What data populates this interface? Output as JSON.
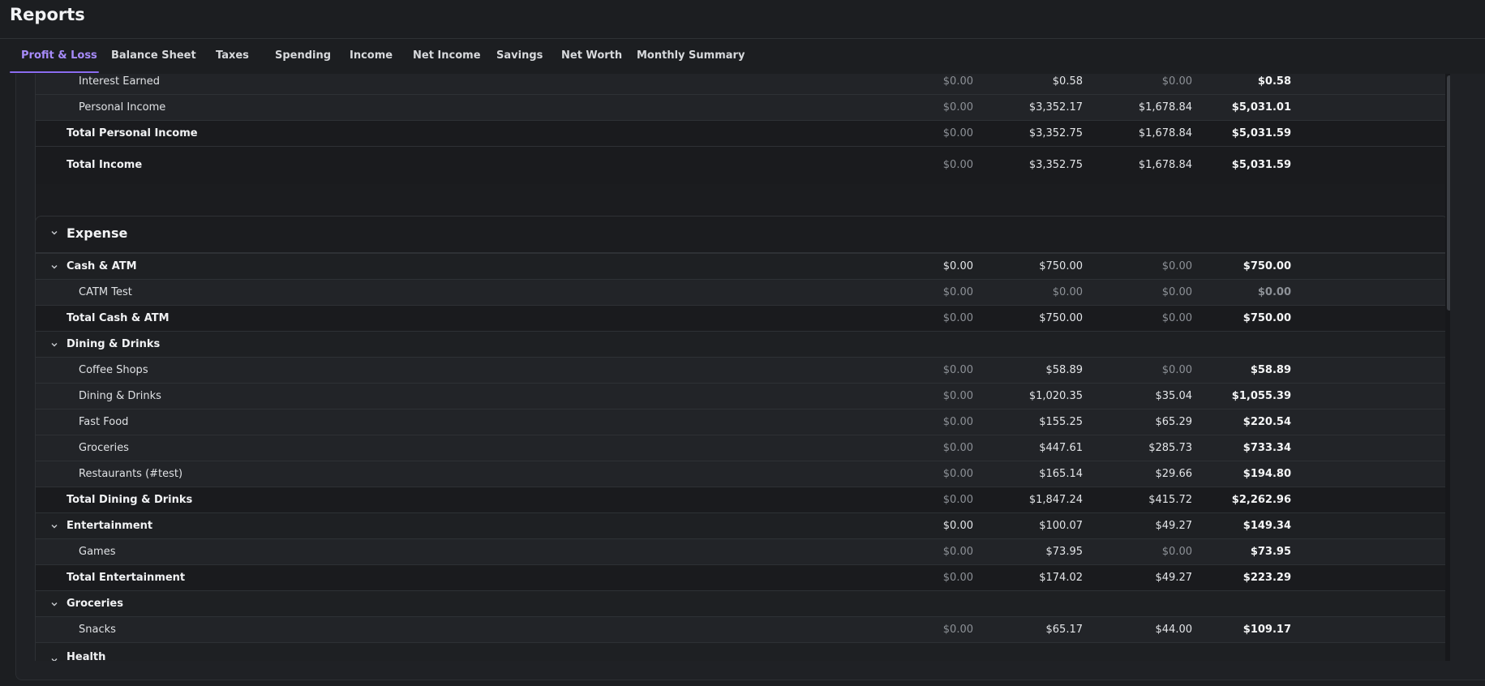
{
  "app": {
    "title": "Reports"
  },
  "tabs": [
    {
      "label": "Profit & Loss",
      "active": true
    },
    {
      "label": "Balance Sheet"
    },
    {
      "label": "Taxes"
    },
    {
      "label": "Spending"
    },
    {
      "label": "Income"
    },
    {
      "label": "Net Income"
    },
    {
      "label": "Savings"
    },
    {
      "label": "Net Worth"
    },
    {
      "label": "Monthly Summary"
    }
  ],
  "colors": {
    "accent": "#a78bfa",
    "background": "#1c1e21",
    "muted_value": "#8d9197"
  },
  "income_section": {
    "rows": [
      {
        "label": "Interest Earned",
        "values": [
          "$0.00",
          "$0.58",
          "$0.00",
          "$0.58"
        ]
      },
      {
        "label": "Personal Income",
        "values": [
          "$0.00",
          "$3,352.17",
          "$1,678.84",
          "$5,031.01"
        ]
      },
      {
        "label": "Total Personal Income",
        "values": [
          "$0.00",
          "$3,352.75",
          "$1,678.84",
          "$5,031.59"
        ]
      },
      {
        "label": "Total Income",
        "values": [
          "$0.00",
          "$3,352.75",
          "$1,678.84",
          "$5,031.59"
        ]
      }
    ]
  },
  "expense_section": {
    "title": "Expense",
    "rows": [
      {
        "label": "Cash & ATM",
        "values": [
          "$0.00",
          "$750.00",
          "$0.00",
          "$750.00"
        ]
      },
      {
        "label": "CATM Test",
        "values": [
          "$0.00",
          "$0.00",
          "$0.00",
          "$0.00"
        ]
      },
      {
        "label": "Total Cash & ATM",
        "values": [
          "$0.00",
          "$750.00",
          "$0.00",
          "$750.00"
        ]
      },
      {
        "label": "Dining & Drinks",
        "values": [
          "",
          "",
          "",
          ""
        ]
      },
      {
        "label": "Coffee Shops",
        "values": [
          "$0.00",
          "$58.89",
          "$0.00",
          "$58.89"
        ]
      },
      {
        "label": "Dining & Drinks",
        "values": [
          "$0.00",
          "$1,020.35",
          "$35.04",
          "$1,055.39"
        ]
      },
      {
        "label": "Fast Food",
        "values": [
          "$0.00",
          "$155.25",
          "$65.29",
          "$220.54"
        ]
      },
      {
        "label": "Groceries",
        "values": [
          "$0.00",
          "$447.61",
          "$285.73",
          "$733.34"
        ]
      },
      {
        "label": "Restaurants (#test)",
        "values": [
          "$0.00",
          "$165.14",
          "$29.66",
          "$194.80"
        ]
      },
      {
        "label": "Total Dining & Drinks",
        "values": [
          "$0.00",
          "$1,847.24",
          "$415.72",
          "$2,262.96"
        ]
      },
      {
        "label": "Entertainment",
        "values": [
          "$0.00",
          "$100.07",
          "$49.27",
          "$149.34"
        ]
      },
      {
        "label": "Games",
        "values": [
          "$0.00",
          "$73.95",
          "$0.00",
          "$73.95"
        ]
      },
      {
        "label": "Total Entertainment",
        "values": [
          "$0.00",
          "$174.02",
          "$49.27",
          "$223.29"
        ]
      },
      {
        "label": "Groceries",
        "values": [
          "",
          "",
          "",
          ""
        ]
      },
      {
        "label": "Snacks",
        "values": [
          "$0.00",
          "$65.17",
          "$44.00",
          "$109.17"
        ]
      },
      {
        "label": "Health",
        "values": [
          "",
          "",
          "",
          ""
        ]
      }
    ]
  },
  "icons": {
    "collapse": "chevron-down-icon"
  }
}
